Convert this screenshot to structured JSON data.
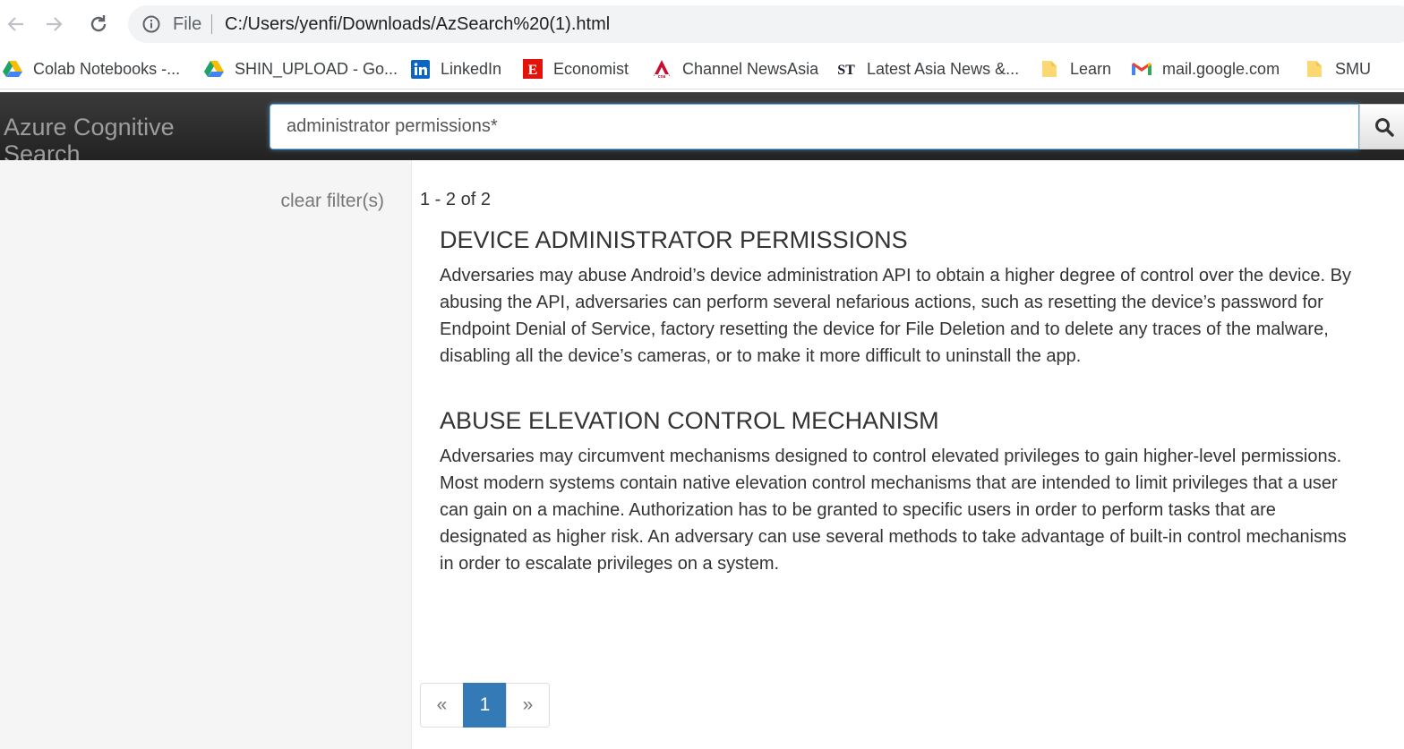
{
  "browser": {
    "omnibox_prefix": "File",
    "url": "C:/Users/yenfi/Downloads/AzSearch%20(1).html"
  },
  "bookmarks": [
    {
      "label": "Colab Notebooks -...",
      "icon": "google-drive-icon"
    },
    {
      "label": "SHIN_UPLOAD - Go...",
      "icon": "google-drive-icon"
    },
    {
      "label": "LinkedIn",
      "icon": "linkedin-icon"
    },
    {
      "label": "Economist",
      "icon": "economist-icon"
    },
    {
      "label": "Channel NewsAsia",
      "icon": "cna-icon"
    },
    {
      "label": "Latest Asia News &...",
      "icon": "straits-times-icon"
    },
    {
      "label": "Learn",
      "icon": "folder-icon"
    },
    {
      "label": "mail.google.com",
      "icon": "gmail-icon"
    },
    {
      "label": "SMU",
      "icon": "folder-icon"
    }
  ],
  "header": {
    "brand": "Azure Cognitive Search",
    "search_value": "administrator permissions*"
  },
  "sidebar": {
    "clear_filter": "clear filter(s)"
  },
  "results": {
    "count_text": "1 - 2 of 2",
    "items": [
      {
        "title": "DEVICE ADMINISTRATOR PERMISSIONS",
        "description": "Adversaries may abuse Android’s device administration API to obtain a higher degree of control over the device. By abusing the API, adversaries can perform several nefarious actions, such as resetting the device’s password for Endpoint Denial of Service, factory resetting the device for File Deletion and to delete any traces of the malware, disabling all the device’s cameras, or to make it more difficult to uninstall the app."
      },
      {
        "title": "ABUSE ELEVATION CONTROL MECHANISM",
        "description": "Adversaries may circumvent mechanisms designed to control elevated privileges to gain higher-level permissions. Most modern systems contain native elevation control mechanisms that are intended to limit privileges that a user can gain on a machine. Authorization has to be granted to specific users in order to perform tasks that are designated as higher risk. An adversary can use several methods to take advantage of built-in control mechanisms in order to escalate privileges on a system."
      }
    ]
  },
  "pagination": {
    "prev": "«",
    "current": "1",
    "next": "»"
  },
  "colors": {
    "header_bg": "#222222",
    "accent": "#337ab7",
    "sidebar_bg": "#f5f5f5"
  }
}
